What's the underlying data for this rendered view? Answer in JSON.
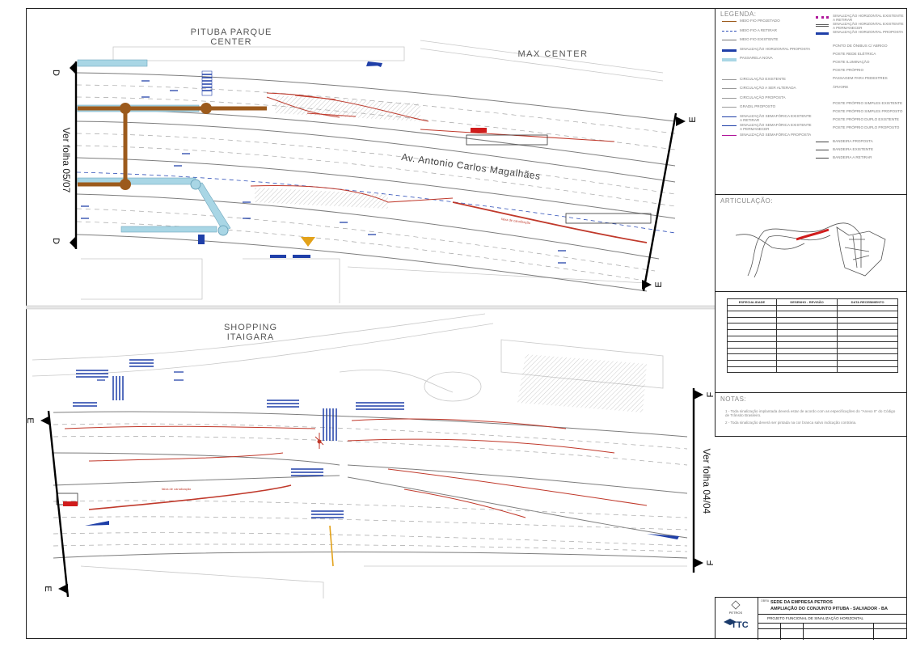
{
  "labels": {
    "pituba_center": [
      "PITUBA PARQUE",
      "CENTER"
    ],
    "max_center": "MAX CENTER",
    "shopping": [
      "SHOPPING",
      "ITAIGARA"
    ],
    "avenue": "Av. Antonio Carlos Magalhães",
    "ver_folha_top": "Ver folha 05/07",
    "ver_folha_bottom": "Ver folha 04/04",
    "section_d": "D",
    "section_e": "E",
    "section_f": "F",
    "faixa": "faixa de canalização"
  },
  "legend": {
    "title": "LEGENDA:",
    "left_items": [
      "MEIO FIO PROJETADO",
      "MEIO FIO A RETIRAR",
      "MEIO FIO EXISTENTE",
      "SINALIZAÇÃO HORIZONTAL PROPOSTA",
      "PASSARELA NOVA",
      "CIRCULAÇÃO EXISTENTE",
      "CIRCULAÇÃO A SER ALTERADA",
      "CIRCULAÇÃO PROPOSTA",
      "GRADIL PROPOSTO",
      "SINALIZAÇÃO SEMAFÓRICA EXISTENTE A RETIRAR",
      "SINALIZAÇÃO SEMAFÓRICA EXISTENTE A PERMANECER",
      "SINALIZAÇÃO SEMAFÓRICA PROPOSTA"
    ],
    "right_items": [
      "SINALIZAÇÃO HORIZONTAL EXISTENTE A RETIRAR",
      "SINALIZAÇÃO HORIZONTAL EXISTENTE A PERMANECER",
      "SINALIZAÇÃO HORIZONTAL PROPOSTA",
      "PONTO DE ÔNIBUS C/ ABRIGO",
      "POSTE REDE ELÉTRICA",
      "POSTE ILUMINAÇÃO",
      "POSTE PRÓPRIO",
      "PASSAGEM PARA PEDESTRES",
      "ÁRVORE",
      "POSTE PRÓPRIO SIMPLES EXISTENTE",
      "POSTE PRÓPRIO SIMPLES PROPOSTO",
      "POSTE PRÓPRIO DUPLO EXISTENTE",
      "POSTE PRÓPRIO DUPLO PROPOSTO",
      "BANDEIRA PROPOSTA",
      "BANDEIRA EXISTENTE",
      "BANDEIRA A RETIRAR"
    ]
  },
  "articulacao": {
    "title": "ARTICULAÇÃO:"
  },
  "revisions": {
    "headers": [
      "ESPECIALIDADE",
      "DESENHO - REVISÃO",
      "DATA RECEBIMENTO"
    ],
    "rows": 11
  },
  "notas": {
    "title": "NOTAS:",
    "items": [
      "1 - Toda sinalização implantada deverá estar de acordo com as especificações do \"Anexo II\" do Código de Trânsito Brasileiro.",
      "2 - Toda sinalização deverá ser pintada na cor branca salvo indicação contrária."
    ]
  },
  "title_block": {
    "line1": "SEDE DA EMPRESA PETROS",
    "line2": "AMPLIAÇÃO DO CONJUNTO PITUBA - SALVADOR - BA",
    "line3": "PROJETO FUNCIONAL DE SINALIZAÇÃO HORIZONTAL",
    "client": "PETROS",
    "company": "TTC"
  },
  "colors": {
    "road": "#9a9a9a",
    "curb": "#c0392b",
    "marking": "#1f3fa8",
    "walkway": "#a9d6e5",
    "proposed": "#9c5a1c"
  }
}
